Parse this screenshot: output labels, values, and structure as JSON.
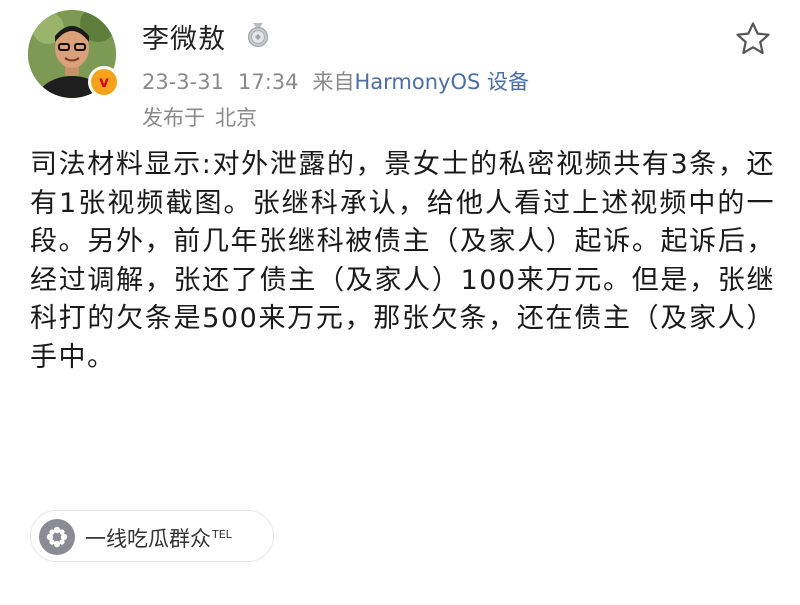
{
  "author": {
    "name": "李微敖",
    "avatar_icon": "person-avatar",
    "verified_icon": "verified-v-badge",
    "verified_symbol": "v",
    "medal_icon": "silver-medal-badge"
  },
  "meta": {
    "date": "23-3-31",
    "time": "17:34",
    "from_label": "来自",
    "device": "HarmonyOS 设备",
    "location_prefix": "发布于",
    "location": "北京"
  },
  "actions": {
    "favorite_icon": "star-outline"
  },
  "post": {
    "text": "司法材料显示:对外泄露的，景女士的私密视频共有3条，还有1张视频截图。张继科承认，给他人看过上述视频中的一段。另外，前几年张继科被债主（及家人）起诉。起诉后，经过调解，张还了债主（及家人）100来万元。但是，张继科打的欠条是500来万元，那张欠条，还在债主（及家人）手中。"
  },
  "topic": {
    "label": "一线吃瓜群众",
    "suffix": "TEL",
    "icon": "flower-icon"
  },
  "colors": {
    "accent_link": "#4a6fa5",
    "meta_gray": "#8a8a8a",
    "badge_orange": "#f7a21b",
    "badge_red": "#d0021b"
  }
}
